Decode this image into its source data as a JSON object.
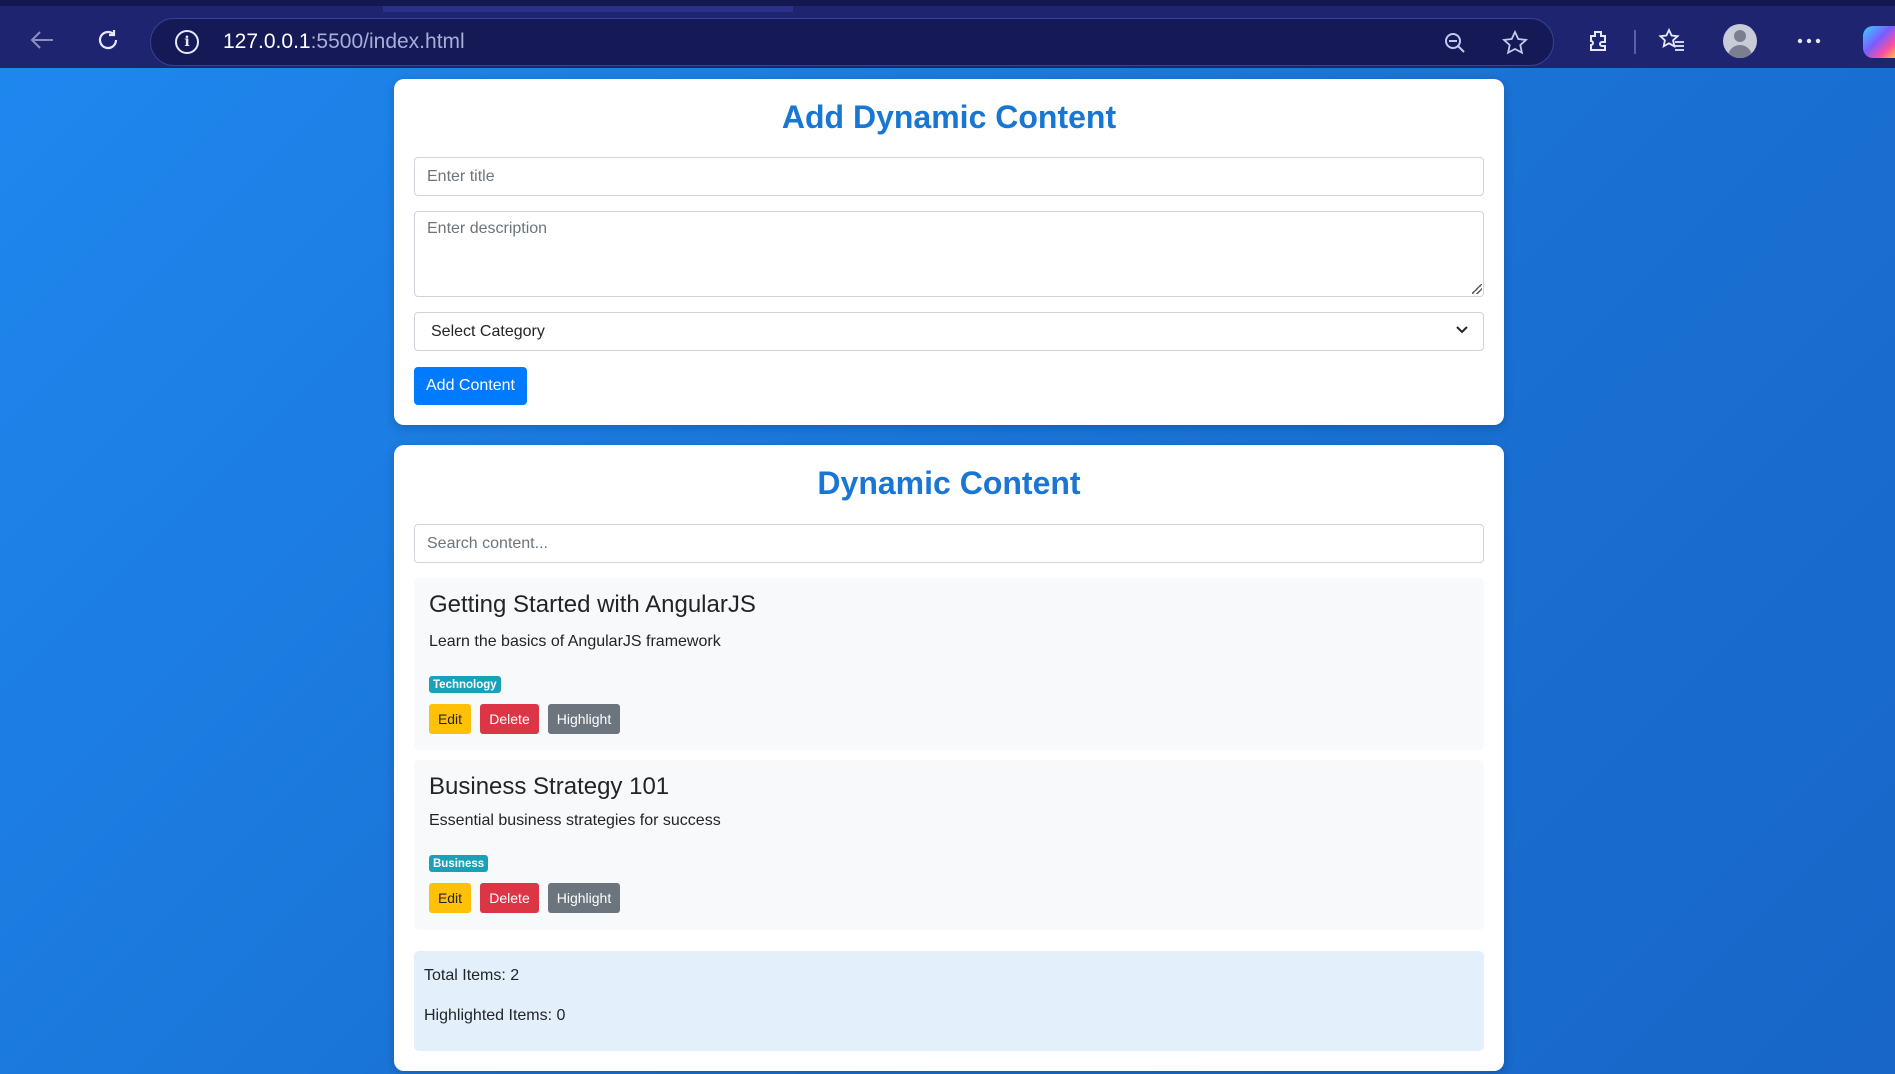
{
  "browser": {
    "url_host": "127.0.0.1",
    "url_path": ":5500/index.html"
  },
  "form_card": {
    "title": "Add Dynamic Content",
    "title_placeholder": "Enter title",
    "description_placeholder": "Enter description",
    "category_selected": "Select Category",
    "add_button_label": "Add Content"
  },
  "content_card": {
    "title": "Dynamic Content",
    "search_placeholder": "Search content...",
    "items": [
      {
        "title": "Getting Started with AngularJS",
        "description": "Learn the basics of AngularJS framework",
        "category": "Technology",
        "edit_label": "Edit",
        "delete_label": "Delete",
        "highlight_label": "Highlight"
      },
      {
        "title": "Business Strategy 101",
        "description": "Essential business strategies for success",
        "category": "Business",
        "edit_label": "Edit",
        "delete_label": "Delete",
        "highlight_label": "Highlight"
      }
    ],
    "stats": {
      "total_items": "Total Items: 2",
      "highlighted_items": "Highlighted Items: 0"
    }
  },
  "colors": {
    "accent": "#1976d2",
    "primary_button": "#007bff",
    "edit_button": "#ffc107",
    "delete_button": "#dc3545",
    "highlight_button": "#6c757d",
    "badge": "#17a2b8"
  },
  "icons": [
    "back-arrow-icon",
    "refresh-icon",
    "info-icon",
    "zoom-out-icon",
    "favorite-star-icon",
    "extensions-icon",
    "favorites-list-icon",
    "profile-avatar-icon",
    "more-menu-icon",
    "copilot-icon"
  ]
}
